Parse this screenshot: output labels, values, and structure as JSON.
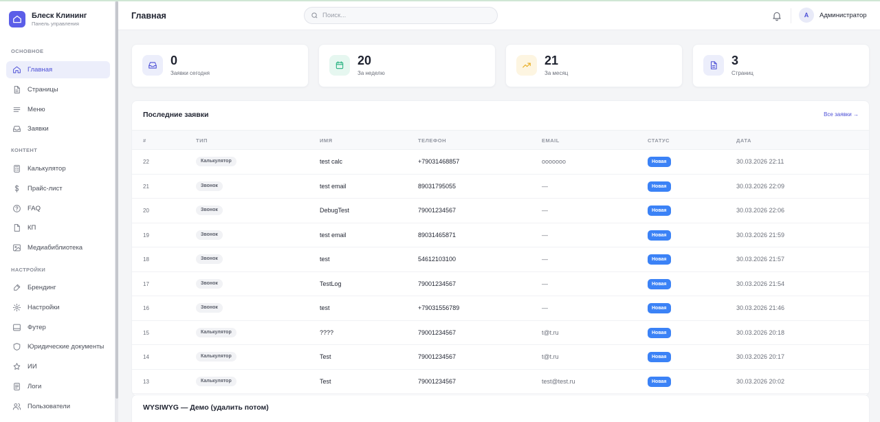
{
  "brand": {
    "name": "Блеск Клининг",
    "subtitle": "Панель управления"
  },
  "sidebar": {
    "sections": [
      {
        "title": "ОСНОВНОЕ",
        "items": [
          {
            "label": "Главная",
            "icon": "home-icon",
            "active": true
          },
          {
            "label": "Страницы",
            "icon": "file-icon"
          },
          {
            "label": "Меню",
            "icon": "menu-lines-icon"
          },
          {
            "label": "Заявки",
            "icon": "inbox-icon"
          }
        ]
      },
      {
        "title": "КОНТЕНТ",
        "items": [
          {
            "label": "Калькулятор",
            "icon": "calculator-icon"
          },
          {
            "label": "Прайс-лист",
            "icon": "dollar-icon"
          },
          {
            "label": "FAQ",
            "icon": "help-circle-icon"
          },
          {
            "label": "КП",
            "icon": "document-icon"
          },
          {
            "label": "Медиабиблиотека",
            "icon": "image-icon"
          }
        ]
      },
      {
        "title": "НАСТРОЙКИ",
        "items": [
          {
            "label": "Брендинг",
            "icon": "brush-icon"
          },
          {
            "label": "Настройки",
            "icon": "gear-icon"
          },
          {
            "label": "Футер",
            "icon": "footer-layout-icon"
          },
          {
            "label": "Юридические документы",
            "icon": "shield-icon"
          },
          {
            "label": "ИИ",
            "icon": "sparkle-icon"
          },
          {
            "label": "Логи",
            "icon": "log-icon"
          },
          {
            "label": "Пользователи",
            "icon": "users-icon"
          }
        ]
      }
    ]
  },
  "header": {
    "title": "Главная",
    "search_placeholder": "Поиск...",
    "avatar_letter": "A",
    "user_name": "Администратор"
  },
  "stats": [
    {
      "value": "0",
      "caption": "Заявки сегодня",
      "icon": "inbox-icon",
      "color": "#4d50d6",
      "bg": "#eceefb"
    },
    {
      "value": "20",
      "caption": "За неделю",
      "icon": "calendar-icon",
      "color": "#22b07d",
      "bg": "#e6f7f0"
    },
    {
      "value": "21",
      "caption": "За месяц",
      "icon": "trending-up-icon",
      "color": "#e6a817",
      "bg": "#fdf5e1"
    },
    {
      "value": "3",
      "caption": "Страниц",
      "icon": "file-icon",
      "color": "#4d50d6",
      "bg": "#eceefb"
    }
  ],
  "requests": {
    "title": "Последние заявки",
    "all_link": "Все заявки →",
    "columns": [
      "#",
      "ТИП",
      "ИМЯ",
      "ТЕЛЕФОН",
      "EMAIL",
      "СТАТУС",
      "ДАТА"
    ],
    "rows": [
      {
        "id": "22",
        "type": "Калькулятор",
        "name": "test calc",
        "phone": "+79031468857",
        "email": "ooooooo",
        "status": "Новая",
        "date": "30.03.2026 22:11"
      },
      {
        "id": "21",
        "type": "Звонок",
        "name": "test email",
        "phone": "89031795055",
        "email": "—",
        "status": "Новая",
        "date": "30.03.2026 22:09"
      },
      {
        "id": "20",
        "type": "Звонок",
        "name": "DebugTest",
        "phone": "79001234567",
        "email": "—",
        "status": "Новая",
        "date": "30.03.2026 22:06"
      },
      {
        "id": "19",
        "type": "Звонок",
        "name": "test email",
        "phone": "89031465871",
        "email": "—",
        "status": "Новая",
        "date": "30.03.2026 21:59"
      },
      {
        "id": "18",
        "type": "Звонок",
        "name": "test",
        "phone": "54612103100",
        "email": "—",
        "status": "Новая",
        "date": "30.03.2026 21:57"
      },
      {
        "id": "17",
        "type": "Звонок",
        "name": "TestLog",
        "phone": "79001234567",
        "email": "—",
        "status": "Новая",
        "date": "30.03.2026 21:54"
      },
      {
        "id": "16",
        "type": "Звонок",
        "name": "test",
        "phone": "+79031556789",
        "email": "—",
        "status": "Новая",
        "date": "30.03.2026 21:46"
      },
      {
        "id": "15",
        "type": "Калькулятор",
        "name": "????",
        "phone": "79001234567",
        "email": "t@t.ru",
        "status": "Новая",
        "date": "30.03.2026 20:18"
      },
      {
        "id": "14",
        "type": "Калькулятор",
        "name": "Test",
        "phone": "79001234567",
        "email": "t@t.ru",
        "status": "Новая",
        "date": "30.03.2026 20:17"
      },
      {
        "id": "13",
        "type": "Калькулятор",
        "name": "Test",
        "phone": "79001234567",
        "email": "test@test.ru",
        "status": "Новая",
        "date": "30.03.2026 20:02"
      }
    ]
  },
  "wysiwyg": {
    "title": "WYSIWYG — Демо (удалить потом)"
  }
}
